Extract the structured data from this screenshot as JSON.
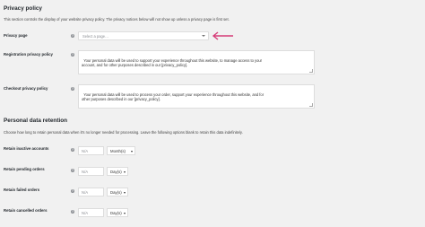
{
  "privacy_policy": {
    "heading": "Privacy policy",
    "description": "This section controls the display of your website privacy policy. The privacy notices below will not show up unless a privacy page is first set.",
    "privacy_page": {
      "label": "Privacy page",
      "placeholder": "Select a page…"
    },
    "registration": {
      "label": "Registration privacy policy",
      "text": "Your personal data will be used to support your experience throughout this website, to manage access to your\naccount, and for other purposes described in our [privacy_policy]."
    },
    "checkout": {
      "label": "Checkout privacy policy",
      "text": "Your personal data will be used to process your order, support your experience throughout this website, and for\nother purposes described in our [privacy_policy]."
    }
  },
  "retention": {
    "heading": "Personal data retention",
    "description": "Choose how long to retain personal data when it's no longer needed for processing. Leave the following options blank to retain this data indefinitely.",
    "rows": [
      {
        "label": "Retain inactive accounts",
        "value_placeholder": "N/A",
        "unit": "Month(s)"
      },
      {
        "label": "Retain pending orders",
        "value_placeholder": "N/A",
        "unit": "Day(s)"
      },
      {
        "label": "Retain failed orders",
        "value_placeholder": "N/A",
        "unit": "Day(s)"
      },
      {
        "label": "Retain cancelled orders",
        "value_placeholder": "N/A",
        "unit": "Day(s)"
      }
    ]
  },
  "help_icon_glyph": "?",
  "icons": {
    "help": "help-icon",
    "arrow": "arrow-left-icon",
    "caret": "chevron-down-icon"
  },
  "colors": {
    "background": "#f1f1f1",
    "arrow": "#d63c78",
    "help": "#8c8f94"
  }
}
